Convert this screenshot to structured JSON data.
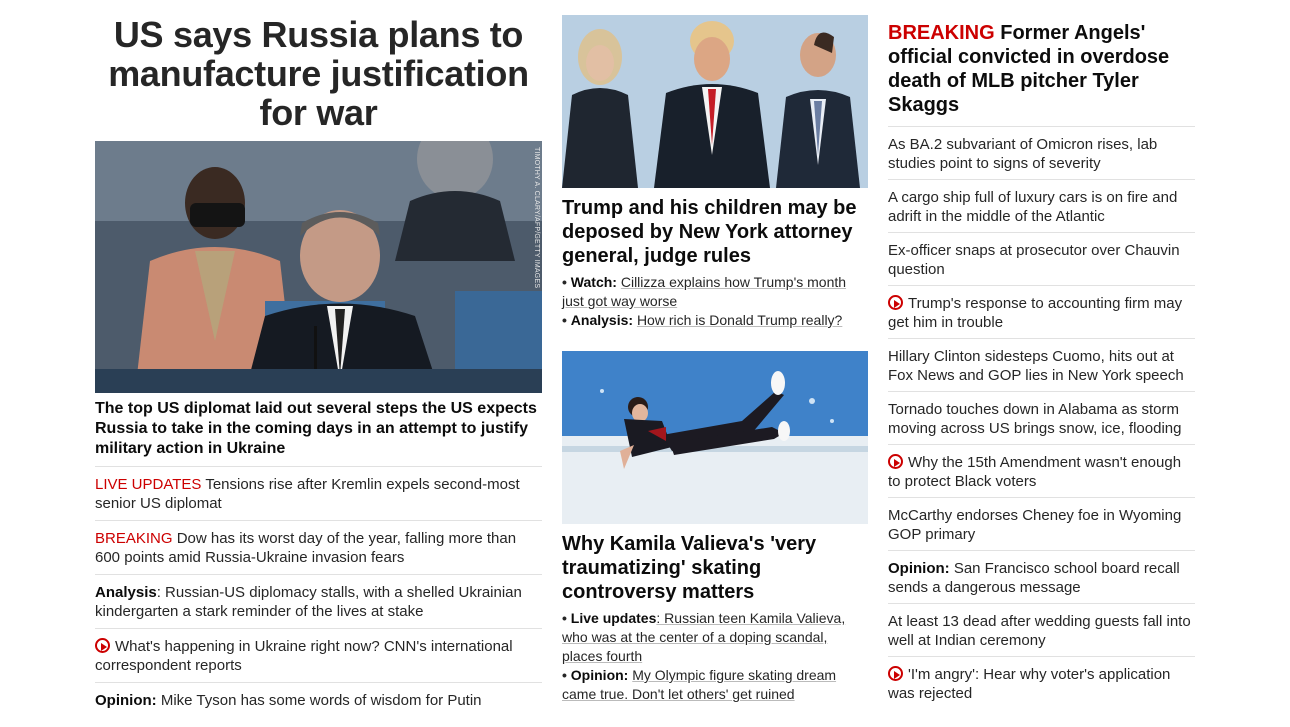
{
  "col1": {
    "headline": "US says Russia plans to manufacture justification for war",
    "hero_credit": "TIMOTHY A. CLARY/AFP/GETTY IMAGES",
    "hero_desc": "The top US diplomat laid out several steps the US expects Russia to take in the coming days in an attempt to justify military action in Ukraine",
    "items": [
      {
        "prefix": "LIVE UPDATES",
        "text": " Tensions rise after Kremlin expels second-most senior US diplomat"
      },
      {
        "prefix": "BREAKING",
        "text": " Dow has its worst day of the year, falling more than 600 points amid Russia-Ukraine invasion fears"
      },
      {
        "prefix": "Analysis",
        "text": ": Russian-US diplomacy stalls, with a shelled Ukrainian kindergarten a stark reminder of the lives at stake"
      },
      {
        "text": "What's happening in Ukraine right now? CNN's international correspondent reports"
      },
      {
        "prefix": "Opinion:",
        "text": " Mike Tyson has some words of wisdom for Putin"
      }
    ]
  },
  "col2": {
    "card1": {
      "title": "Trump and his children may be deposed by New York attorney general, judge rules",
      "sub": [
        {
          "label": "Watch:",
          "text": "Cillizza explains how Trump's month just got way worse"
        },
        {
          "label": "Analysis:",
          "text": "How rich is Donald Trump really?"
        }
      ]
    },
    "card2": {
      "title": "Why Kamila Valieva's 'very traumatizing' skating controversy matters",
      "sub": [
        {
          "label": "Live updates",
          "text": ": Russian teen Kamila Valieva, who was at the center of a doping scandal, places fourth"
        },
        {
          "label": "Opinion:",
          "text": "My Olympic figure skating dream came true. Don't let others' get ruined"
        }
      ]
    },
    "bullet": "•"
  },
  "col3": {
    "breaking_label": "BREAKING",
    "breaking_text": " Former Angels' official convicted in overdose death of MLB pitcher Tyler Skaggs",
    "items": [
      {
        "text": "As BA.2 subvariant of Omicron rises, lab studies point to signs of severity"
      },
      {
        "text": "A cargo ship full of luxury cars is on fire and adrift in the middle of the Atlantic"
      },
      {
        "text": "Ex-officer snaps at prosecutor over Chauvin question"
      },
      {
        "text": "Trump's response to accounting firm may get him in trouble"
      },
      {
        "text": "Hillary Clinton sidesteps Cuomo, hits out at Fox News and GOP lies in New York speech"
      },
      {
        "text": "Tornado touches down in Alabama as storm moving across US brings snow, ice, flooding"
      },
      {
        "text": "Why the 15th Amendment wasn't enough to protect Black voters"
      },
      {
        "text": "McCarthy endorses Cheney foe in Wyoming GOP primary"
      },
      {
        "prefix": "Opinion:",
        "text": " San Francisco school board recall sends a dangerous message"
      },
      {
        "text": "At least 13 dead after wedding guests fall into well at Indian ceremony"
      },
      {
        "text": "'I'm angry': Hear why voter's application was rejected"
      }
    ]
  },
  "colors": {
    "accent_red": "#cc0000",
    "text": "#262626",
    "divider": "#e1e1e1"
  },
  "icons": {
    "video": "play-circle-icon"
  }
}
